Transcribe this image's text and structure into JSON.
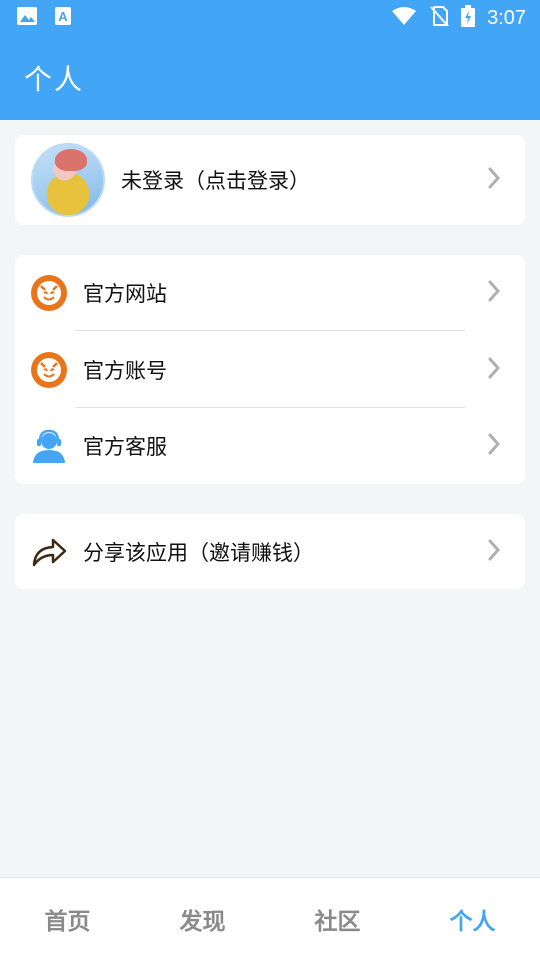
{
  "status_bar": {
    "time": "3:07",
    "icons": [
      "image-icon",
      "font-a-icon",
      "wifi-icon",
      "no-sim-icon",
      "battery-charging-icon"
    ]
  },
  "app_bar": {
    "title": "个人"
  },
  "profile": {
    "label": "未登录（点击登录）",
    "avatar": "avatar-image"
  },
  "menu": {
    "items": [
      {
        "label": "官方网站",
        "icon": "devil-logo-icon"
      },
      {
        "label": "官方账号",
        "icon": "devil-logo-icon"
      },
      {
        "label": "官方客服",
        "icon": "customer-service-icon"
      }
    ]
  },
  "share": {
    "label": "分享该应用（邀请赚钱）",
    "icon": "share-arrow-icon"
  },
  "tabs": [
    {
      "label": "首页",
      "active": false
    },
    {
      "label": "发现",
      "active": false
    },
    {
      "label": "社区",
      "active": false
    },
    {
      "label": "个人",
      "active": true
    }
  ],
  "colors": {
    "primary": "#42a5f5",
    "accent_orange": "#e8751a",
    "tab_inactive": "#8a8a8a",
    "background": "#f4f5f7"
  }
}
